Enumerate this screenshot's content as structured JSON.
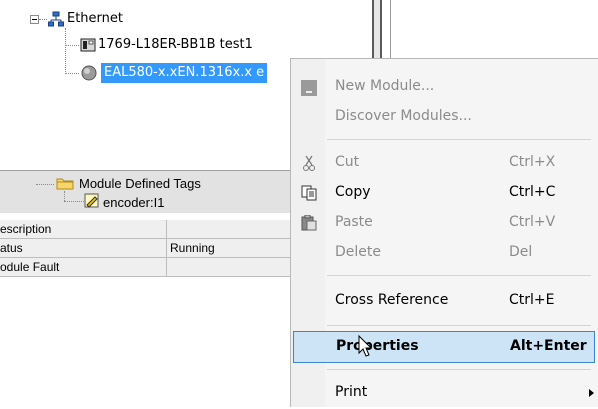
{
  "tree": {
    "nodes": [
      {
        "label": "Ethernet"
      },
      {
        "label": "1769-L18ER-BB1B test1"
      },
      {
        "label": "EAL580-x.xEN.1316x.x e"
      }
    ]
  },
  "props": {
    "tags_label": "Module Defined Tags",
    "encoder_label": "encoder:I1",
    "rows": [
      {
        "name": "escription",
        "value": ""
      },
      {
        "name": "atus",
        "value": "Running"
      },
      {
        "name": "odule Fault",
        "value": ""
      }
    ]
  },
  "menu": {
    "items": [
      {
        "label": "New Module...",
        "shortcut": "",
        "enabled": false
      },
      {
        "label": "Discover Modules...",
        "shortcut": "",
        "enabled": false
      },
      {
        "label": "Cut",
        "shortcut": "Ctrl+X",
        "enabled": false
      },
      {
        "label": "Copy",
        "shortcut": "Ctrl+C",
        "enabled": true
      },
      {
        "label": "Paste",
        "shortcut": "Ctrl+V",
        "enabled": false
      },
      {
        "label": "Delete",
        "shortcut": "Del",
        "enabled": false
      },
      {
        "label": "Cross Reference",
        "shortcut": "Ctrl+E",
        "enabled": true
      },
      {
        "label": "Properties",
        "shortcut": "Alt+Enter",
        "enabled": true,
        "highlighted": true
      },
      {
        "label": "Print",
        "shortcut": "",
        "enabled": true,
        "submenu": true
      }
    ]
  },
  "icons": [
    "network-icon",
    "controller-icon",
    "encoder-module-icon",
    "folder-icon",
    "tag-icon",
    "new-module-icon",
    "scissors-icon",
    "copy-icon",
    "paste-icon",
    "mouse-cursor-icon"
  ],
  "colors": {
    "selection": "#3399ff",
    "highlight_fill": "#cde4f7",
    "highlight_border": "#3c86c9",
    "disabled_text": "#8b8b8b"
  }
}
